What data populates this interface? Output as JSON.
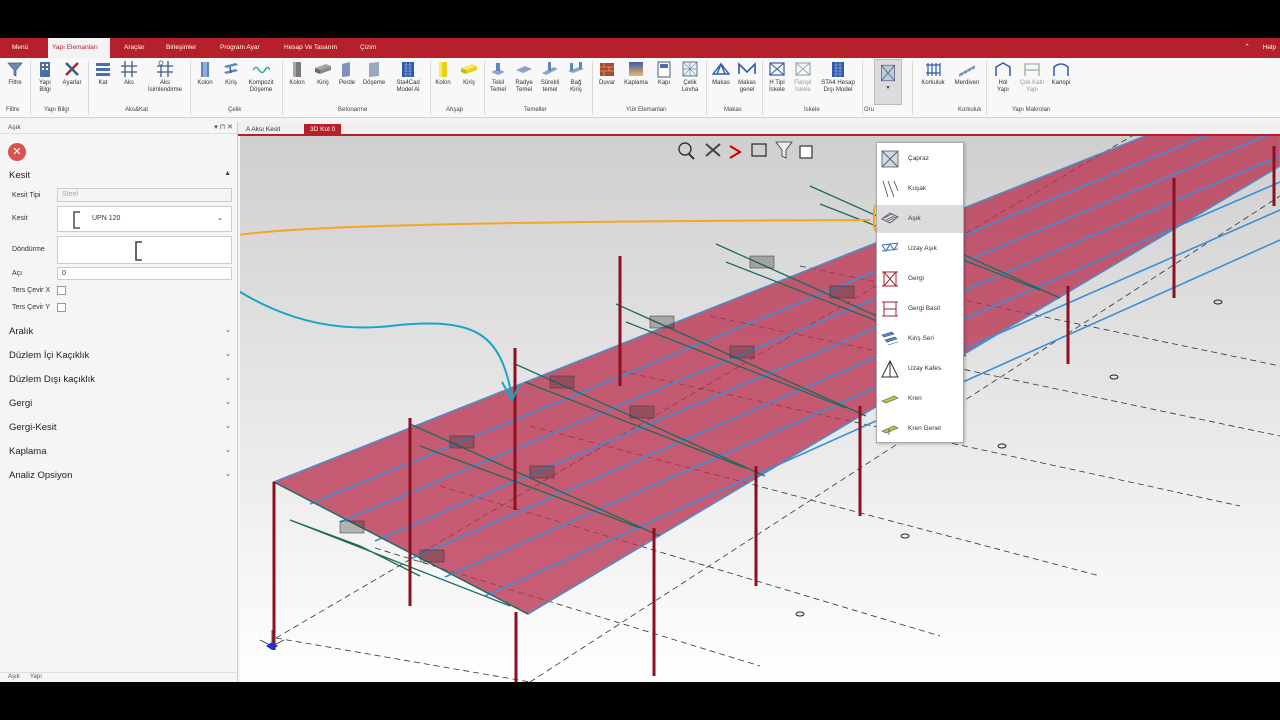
{
  "menu": {
    "tabs": [
      "Menü",
      "Yapı Elemanları",
      "Araçlar",
      "Birleşimler",
      "Program Ayar",
      "Hesap Ve Tasarım",
      "Çizim"
    ],
    "active_index": 1,
    "help": "Help",
    "collapse_icon": "chevron-up-icon"
  },
  "ribbon": {
    "filtre": "Filtre",
    "yapi_bilgi": "Yapı\nBilgi",
    "ayarlar": "Ayarlar",
    "kat": "Kat",
    "aks": "Aks",
    "aks_isim": "Aks\nİsimlendirme",
    "kolon1": "Kolon",
    "kiris1": "Kiriş",
    "kompozit": "Kompozit\nDöşeme",
    "kolon2": "Kolon",
    "kiris2": "Kiriş",
    "perde": "Perde",
    "doseme": "Döşeme",
    "sta4cad": "Sta4Cad\nModel Al",
    "kolon3": "Kolon",
    "kiris3": "Kiriş",
    "tekil": "Tekil\nTemel",
    "radye": "Radye\nTemel",
    "surekli": "Sürekli\ntemel",
    "bag": "Bağ\nKiriş",
    "duvar": "Duvar",
    "kaplama": "Kaplama",
    "kapi": "Kapı",
    "celik_levha": "Çelik\nLevha",
    "makas": "Makas",
    "makas_genel": "Makas\ngenel",
    "h_tipi": "H Tipi\nİskele",
    "flansli": "Flanşlı\nİskele",
    "sta4_hesap": "STA4 Hesap\nDışı Model",
    "korkuluk": "Korkuluk",
    "merdiven": "Merdiven",
    "hol": "Hol\nYapı",
    "cok_katli": "Çok Katlı\nYapı",
    "kanopi": "Kanopi",
    "groups": {
      "filtre": "Filtre",
      "yapi_bilgi": "Yapı Bilgi",
      "aks_kat": "Aks&Kat",
      "celik": "Çelik",
      "betonarme": "Betonarme",
      "ahsap": "Ahşap",
      "temeller": "Temeller",
      "yuk": "Yük Elemanları",
      "makas": "Makas",
      "iskele": "İskele",
      "gru": "Gru",
      "korkuluk": "Korkuluk",
      "yapi_makro": "Yapı Makroları"
    }
  },
  "panel": {
    "title": "Aşık",
    "section_kesit": "Kesit",
    "kesit_tipi_label": "Kesit Tipi",
    "kesit_tipi_value": "Steel",
    "kesit_label": "Kesit",
    "kesit_value": "UPN 120",
    "dondurme_label": "Döndürme",
    "aci_label": "Açı",
    "aci_value": "0",
    "ters_x": "Ters Çevir X",
    "ters_y": "Ters Çevir Y",
    "sections": [
      "Aralık",
      "Düzlem İçi Kaçıklık",
      "Düzlem Dışı kaçıklık",
      "Gergi",
      "Gergi-Kesit",
      "Kaplama",
      "Analiz Opsiyon"
    ],
    "footer_tabs": [
      "Aşık",
      "Yapı"
    ]
  },
  "doc_tabs": [
    "A Aksı Kesit",
    "3D Kot 0"
  ],
  "dropdown": {
    "items": [
      "Çapraz",
      "Kuşak",
      "Aşık",
      "Uzay Aşık",
      "Gergi",
      "Gergi Basit",
      "Kiriş Seri",
      "Uzay Kafes",
      "Kren",
      "Kren Genel"
    ],
    "selected_index": 2
  },
  "colors": {
    "brand": "#b5202b",
    "annotation_orange": "#f5a623",
    "annotation_blue": "#1ba3c6",
    "roof": "#b8324f",
    "steel_teal": "#2d7d6e"
  }
}
